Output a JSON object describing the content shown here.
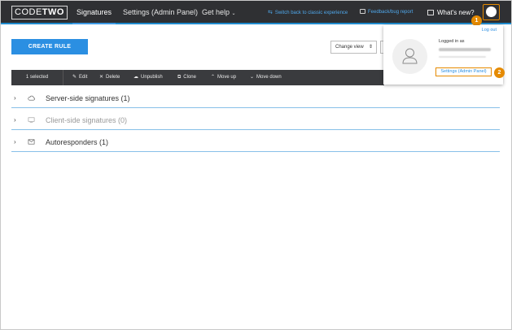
{
  "nav": {
    "logo_a": "CODE",
    "logo_b": "TWO",
    "tab_signatures": "Signatures",
    "tab_settings": "Settings (Admin Panel)",
    "tab_help": "Get help",
    "switch_link": "Switch back to classic experience",
    "feedback_link": "Feedback/bug report",
    "whats_new": "What's new?"
  },
  "callouts": {
    "one": "1",
    "two": "2"
  },
  "main": {
    "create_rule": "CREATE RULE",
    "change_view": "Change view"
  },
  "toolbar": {
    "selected": "1 selected",
    "edit": "Edit",
    "delete": "Delete",
    "unpublish": "Unpublish",
    "clone": "Clone",
    "move_up": "Move up",
    "move_down": "Move down"
  },
  "groups": [
    {
      "title": "Server-side signatures (1)",
      "icon": "cloud-icon"
    },
    {
      "title": "Client-side signatures (0)",
      "icon": "monitor-icon"
    },
    {
      "title": "Autoresponders (1)",
      "icon": "autoresponder-icon"
    }
  ],
  "dropdown": {
    "logout": "Log out",
    "logged_in_as": "Logged in as",
    "settings_link": "Settings (Admin Panel)"
  },
  "colors": {
    "accent": "#2b8fe2",
    "callout": "#e58a00",
    "topbar": "#2f3033"
  }
}
